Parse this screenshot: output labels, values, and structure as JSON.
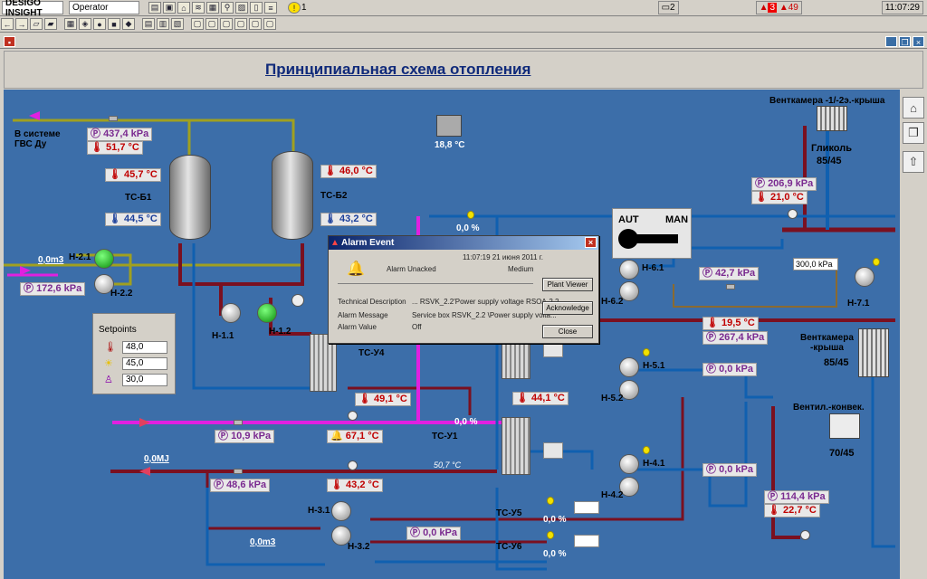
{
  "app": {
    "name": "DESIGO INSIGHT",
    "user": "Operator",
    "alarm_bell_count": "1",
    "window_count": "2",
    "alarm_red": "3",
    "alarm_red2": "49",
    "clock": "11:07:29"
  },
  "title": "Принципиальная схема отопления",
  "labels": {
    "gvs": "В системе\nГВС Ду",
    "tsb1": "ТС-Б1",
    "tsb2": "ТС-Б2",
    "h21": "Н-2.1",
    "h22": "Н-2.2",
    "h11": "Н-1.1",
    "h12": "Н-1.2",
    "tsu4": "ТС-У4",
    "tsu1": "ТС-У1",
    "tsu5": "ТС-У5",
    "tsu6": "ТС-У6",
    "h31": "Н-3.1",
    "h32": "Н-3.2",
    "h61": "Н-6.1",
    "h62": "Н-6.2",
    "h51": "Н-5.1",
    "h52": "Н-5.2",
    "h41": "Н-4.1",
    "h42": "Н-4.2",
    "h71": "Н-7.1",
    "vent_roof": "Венткамера -1/-2э.-крыша",
    "glycol": "Гликоль",
    "glycol_t": "85/45",
    "vent_roof2": "Венткамера\n-крыша",
    "vent_roof2_t": "85/45",
    "ventconv": "Вентил.-конвек.",
    "ventconv_t": "70/45",
    "m3a": "0,0m3",
    "mj": "0,0MJ",
    "m3b": "0,0m3",
    "temp_vent": "18,8 °C",
    "temp_line": "50,7 °C",
    "aut": "AUT",
    "man": "MAN",
    "setpoints": "Setpoints"
  },
  "values": {
    "p1": "437,4 kPa",
    "t1": "51,7 °C",
    "t_tsb1_top": "45,7 °C",
    "t_tsb1_bot": "44,5 °C",
    "t_tsb2_top": "46,0 °C",
    "t_tsb2_bot": "43,2 °C",
    "p_h2": "172,6 kPa",
    "p_gly": "206,9 kPa",
    "t_gly": "21,0 °C",
    "p_h6": "42,7 kPa",
    "p_sel": "300,0 kPa",
    "t_vent2": "19,5 °C",
    "p_vent2": "267,4 kPa",
    "p_h5": "0,0 kPa",
    "t_49": "49,1 °C",
    "t_44": "44,1 °C",
    "p_10": "10,9 kPa",
    "t_67": "67,1 °C",
    "p_h4": "0,0 kPa",
    "p_48": "48,6 kPa",
    "t_43": "43,2 °C",
    "p_conv": "114,4 kPa",
    "t_conv": "22,7 °C",
    "p_h3": "0,0 kPa",
    "valve1": "0,0 %",
    "valve2": "0,0 %",
    "valve3": "0,0 %",
    "valve4": "0,0 %",
    "sp1": "48,0",
    "sp2": "45,0",
    "sp3": "30,0"
  },
  "alarm": {
    "title": "Alarm Event",
    "time": "11:07:19 21 июня 2011 г.",
    "status": "Alarm Unacked",
    "priority": "Medium",
    "td_label": "Technical Description",
    "td_val": "... RSVK_2.2'Power supply voltage RSOA-2.2",
    "msg_label": "Alarm Message",
    "msg_val": "Service box RSVK_2.2 \\Power supply volta...",
    "val_label": "Alarm Value",
    "val_val": "Off",
    "btn_plant": "Plant Viewer",
    "btn_ack": "Acknowledge",
    "btn_close": "Close"
  }
}
